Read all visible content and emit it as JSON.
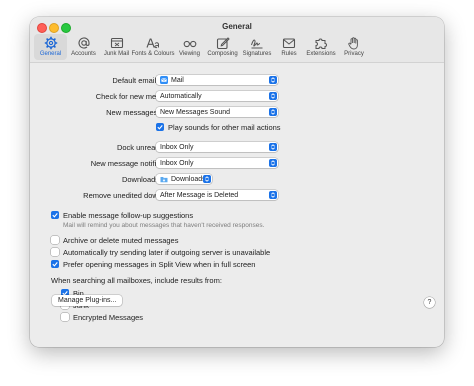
{
  "window": {
    "title": "General"
  },
  "toolbar": {
    "items": [
      {
        "label": "General",
        "icon": "gear-icon",
        "selected": true
      },
      {
        "label": "Accounts",
        "icon": "at-sign-icon"
      },
      {
        "label": "Junk Mail",
        "icon": "junk-tray-icon"
      },
      {
        "label": "Fonts & Colours",
        "icon": "fonts-icon"
      },
      {
        "label": "Viewing",
        "icon": "glasses-icon"
      },
      {
        "label": "Composing",
        "icon": "compose-icon"
      },
      {
        "label": "Signatures",
        "icon": "signature-icon"
      },
      {
        "label": "Rules",
        "icon": "rules-envelope-icon"
      },
      {
        "label": "Extensions",
        "icon": "puzzle-icon"
      },
      {
        "label": "Privacy",
        "icon": "hand-icon"
      }
    ]
  },
  "settings": {
    "default_reader": {
      "label": "Default email reader:",
      "value": "Mail"
    },
    "check_new": {
      "label": "Check for new messages:",
      "value": "Automatically"
    },
    "new_sound": {
      "label": "New messages sound:",
      "value": "New Messages Sound"
    },
    "play_sounds": {
      "label": "Play sounds for other mail actions",
      "checked": true
    },
    "dock_unread": {
      "label": "Dock unread count:",
      "value": "Inbox Only"
    },
    "notifications": {
      "label": "New message notifications:",
      "value": "Inbox Only"
    },
    "downloads_folder": {
      "label": "Downloads folder:",
      "value": "Downloads"
    },
    "remove_downloads": {
      "label": "Remove unedited downloads:",
      "value": "After Message is Deleted"
    }
  },
  "options": {
    "follow_up": {
      "label": "Enable message follow-up suggestions",
      "checked": true,
      "hint": "Mail will remind you about messages that haven't received responses."
    },
    "archive_muted": {
      "label": "Archive or delete muted messages",
      "checked": false
    },
    "auto_resend": {
      "label": "Automatically try sending later if outgoing server is unavailable",
      "checked": false
    },
    "split_view": {
      "label": "Prefer opening messages in Split View when in full screen",
      "checked": true
    }
  },
  "search": {
    "heading": "When searching all mailboxes, include results from:",
    "bin": {
      "label": "Bin",
      "checked": true
    },
    "junk": {
      "label": "Junk",
      "checked": false
    },
    "encrypted": {
      "label": "Encrypted Messages",
      "checked": false
    }
  },
  "buttons": {
    "plugins": "Manage Plug-ins...",
    "help": "?"
  },
  "colors": {
    "accent": "#1a72e8",
    "close": "#ff5f57",
    "minimize": "#febc2e",
    "maximize": "#28c840"
  }
}
